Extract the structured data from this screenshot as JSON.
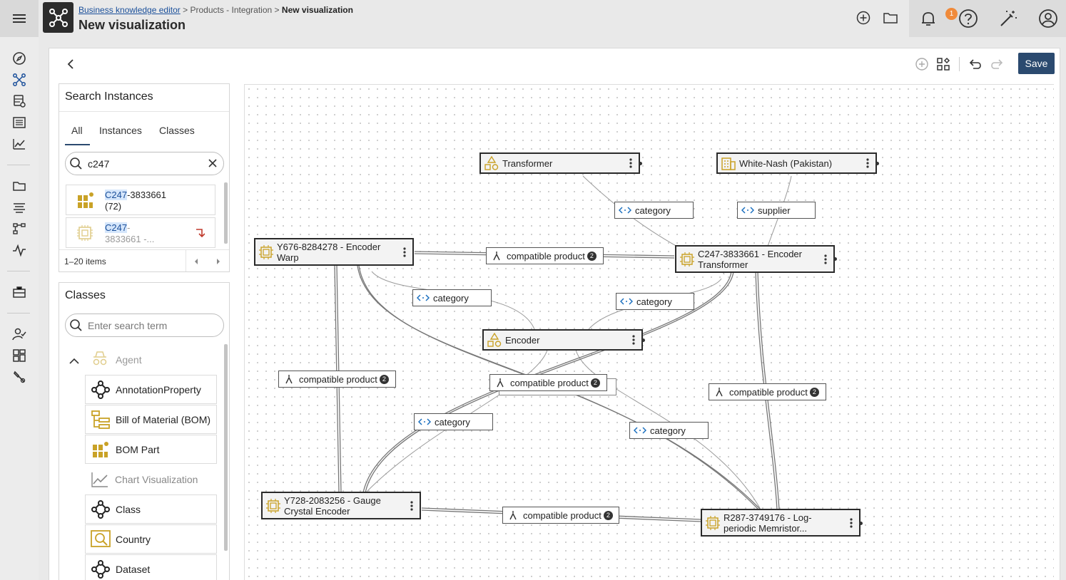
{
  "header": {
    "breadcrumb_root": "Business knowledge editor",
    "breadcrumb_sep1": ">",
    "breadcrumb_mid": "Products - Integration",
    "breadcrumb_sep2": ">",
    "breadcrumb_current": "New visualization",
    "title": "New visualization",
    "notification_count": "1"
  },
  "toolbar": {
    "save_label": "Save"
  },
  "search_panel": {
    "title": "Search Instances",
    "tabs": [
      "All",
      "Instances",
      "Classes"
    ],
    "active_tab": "All",
    "query": "c247",
    "results": [
      {
        "match": "C247",
        "rest": "-3833661",
        "line2": "(72)",
        "disabled": false
      },
      {
        "match": "C247",
        "rest": "-",
        "line2": "3833661 -...",
        "disabled": true
      }
    ],
    "pager_text": "1–20 items"
  },
  "classes_panel": {
    "title": "Classes",
    "search_placeholder": "Enter search term",
    "group": "Agent",
    "items": [
      "AnnotationProperty",
      "Bill of Material (BOM)",
      "BOM Part",
      "Chart Visualization",
      "Class",
      "Country",
      "Dataset"
    ]
  },
  "graph": {
    "nodes": {
      "transformer": "Transformer",
      "white_nash": "White-Nash (Pakistan)",
      "y676": "Y676-8284278 - Encoder Warp",
      "c247": "C247-3833661 - Encoder Transformer",
      "encoder": "Encoder",
      "y728": "Y728-2083256 - Gauge Crystal Encoder",
      "r287": "R287-3749176 - Log-periodic Memristor..."
    },
    "edge_labels": {
      "category": "category",
      "supplier": "supplier",
      "compatible_product": "compatible product",
      "compatible_count": "2"
    }
  },
  "colors": {
    "accent": "#2b4a6f",
    "class_icon": "#c9a227",
    "notification": "#f08a3a"
  }
}
